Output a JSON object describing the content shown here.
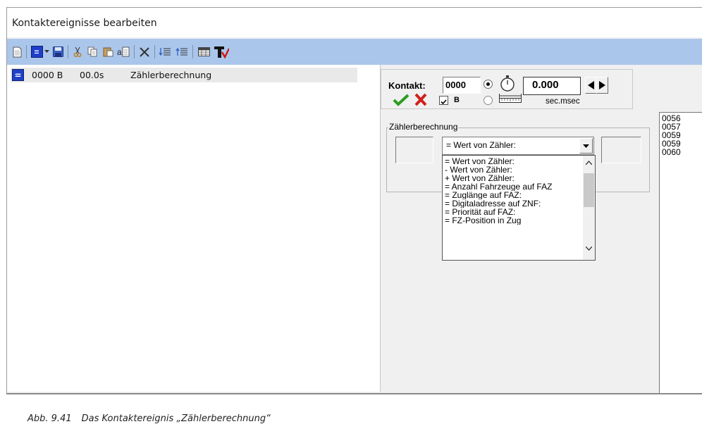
{
  "window": {
    "title": "Kontaktereignisse bearbeiten"
  },
  "toolbar": {
    "icons": [
      "new-document-icon",
      "event-type-icon",
      "dropdown-arrow-icon",
      "save-icon",
      "cut-icon",
      "copy-icon",
      "paste-icon",
      "paste-special-icon",
      "delete-icon",
      "move-down-icon",
      "move-up-icon",
      "table-view-icon",
      "text-tool-icon"
    ]
  },
  "event_list": {
    "rows": [
      {
        "contact": "0000 B",
        "time": "00.0s",
        "type": "Zählerberechnung"
      }
    ]
  },
  "editor": {
    "kontakt_label": "Kontakt:",
    "kontakt_value": "0000",
    "b_label": "B",
    "time_value": "0.000",
    "time_unit": "sec.msec",
    "b_checked": true
  },
  "groupbox": {
    "title": "Zählerberechnung",
    "combo_value": "= Wert von Zähler:",
    "options": [
      "= Wert von Zähler:",
      "- Wert von Zähler:",
      "+ Wert von Zähler:",
      "= Anzahl Fahrzeuge auf FAZ",
      "= Zuglänge auf FAZ:",
      "= Digitaladresse auf ZNF:",
      "= Priorität auf FAZ:",
      "= FZ-Position in Zug"
    ]
  },
  "number_list": [
    "0056",
    "0057",
    "0059",
    "0059",
    "0060"
  ],
  "caption": {
    "number": "Abb. 9.41",
    "text": "Das Kontaktereignis „Zählerberechnung“"
  },
  "colors": {
    "toolbar_bg": "#abc6eb",
    "accent_blue": "#1e3fc8",
    "ok_green": "#2a9d1f",
    "cancel_red": "#d0201c"
  }
}
